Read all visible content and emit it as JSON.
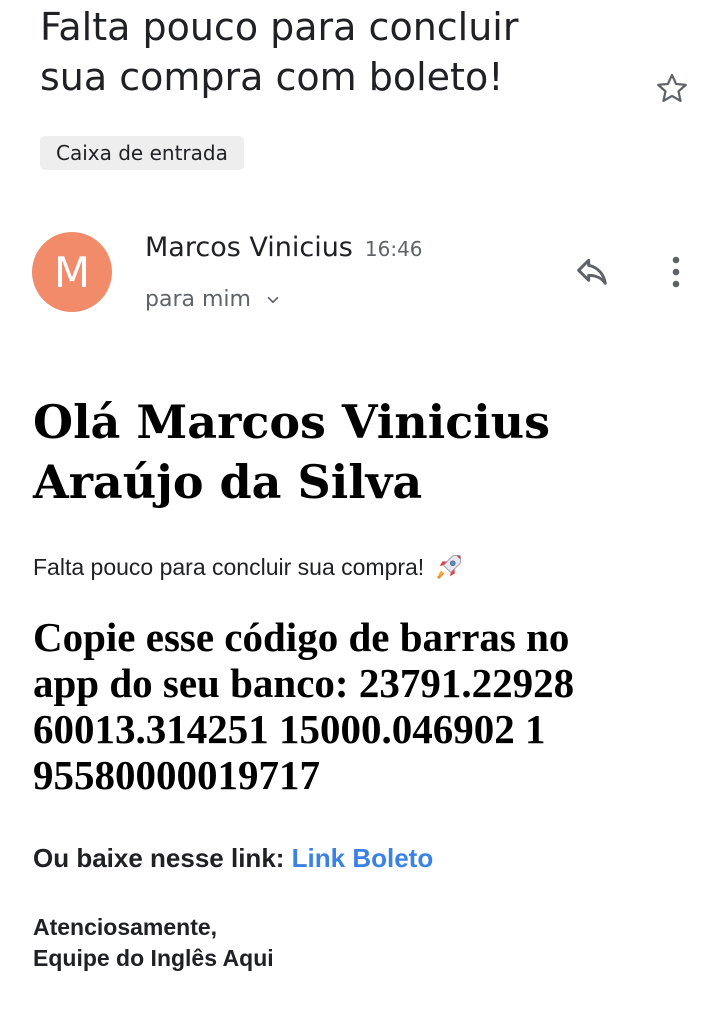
{
  "email": {
    "subject_lines": [
      "Falta pouco para concluir",
      "sua compra com boleto!"
    ],
    "label": "Caixa de entrada",
    "sender": {
      "initial": "M",
      "name": "Marcos Vinicius",
      "time": "16:46",
      "recipient": "para mim",
      "avatar_color": "#f28b6a"
    },
    "icons": {
      "star": "star-outline-icon",
      "reply": "reply-icon",
      "more": "more-vert-icon",
      "expand": "chevron-down-icon",
      "emoji": "rocket-icon"
    }
  },
  "body": {
    "greeting_lines": [
      "Olá Marcos Vinicius",
      "Araújo da Silva"
    ],
    "intro": "Falta pouco para concluir sua compra!",
    "barcode_lines": [
      "Copie esse código de barras no",
      "app do seu banco: 23791.22928",
      "60013.314251 15000.046902 1",
      "95580000019717"
    ],
    "download_prefix": "Ou baixe nesse link:",
    "download_link": "Link Boleto",
    "link_color": "#3b82e6",
    "signoff_lines": [
      "Atenciosamente,",
      "Equipe do Inglês Aqui"
    ]
  }
}
